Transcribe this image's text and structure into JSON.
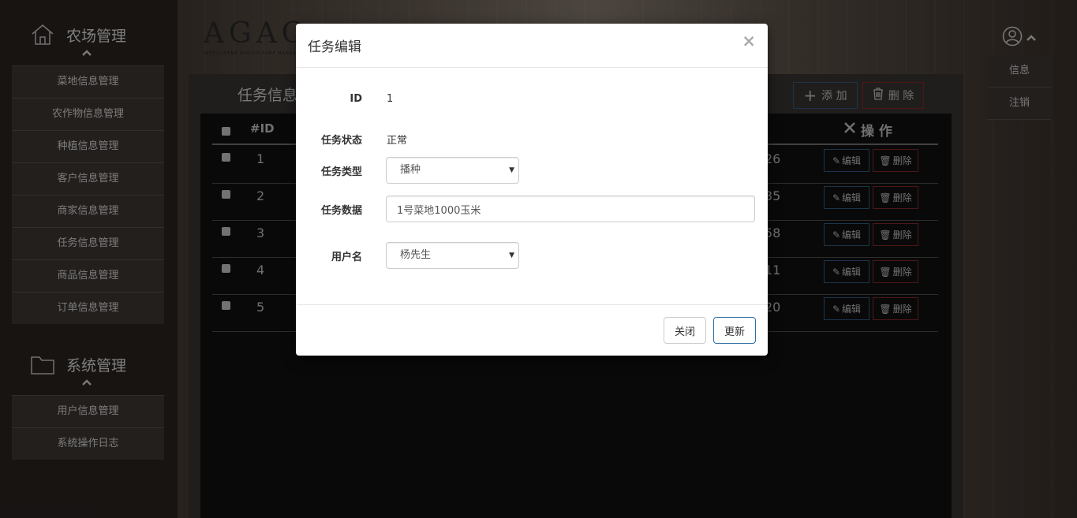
{
  "sidebar": {
    "farm_title": "农场管理",
    "farm_items": [
      {
        "label": "菜地信息管理"
      },
      {
        "label": "农作物信息管理"
      },
      {
        "label": "种植信息管理"
      },
      {
        "label": "客户信息管理"
      },
      {
        "label": "商家信息管理"
      },
      {
        "label": "任务信息管理"
      },
      {
        "label": "商品信息管理"
      },
      {
        "label": "订单信息管理"
      }
    ],
    "system_title": "系统管理",
    "system_items": [
      {
        "label": "用户信息管理"
      },
      {
        "label": "系统操作日志"
      }
    ]
  },
  "logo": {
    "text": "AGAC",
    "subtitle": "INTELLIGENT AGRICULTURE MANAGEMENT SYSTEM"
  },
  "main": {
    "title": "任务信息",
    "add_label": "添 加",
    "delete_label": "删 除",
    "table": {
      "id_header": "#ID",
      "op_header": "操 作",
      "edit_label": "编辑",
      "remove_label": "删除",
      "rows": [
        {
          "id": "1",
          "tail": "26"
        },
        {
          "id": "2",
          "tail": "35"
        },
        {
          "id": "3",
          "tail": "58"
        },
        {
          "id": "4",
          "tail": "11"
        },
        {
          "id": "5",
          "tail": "20"
        }
      ]
    }
  },
  "user_menu": {
    "items": [
      {
        "label": "信息"
      },
      {
        "label": "注销"
      }
    ]
  },
  "modal": {
    "title": "任务编辑",
    "close_glyph": "×",
    "fields": {
      "id_label": "ID",
      "id_value": "1",
      "status_label": "任务状态",
      "status_value": "正常",
      "type_label": "任务类型",
      "type_value": "播种",
      "data_label": "任务数据",
      "data_value": "1号菜地1000玉米",
      "user_label": "用户名",
      "user_value": "杨先生"
    },
    "close_button": "关闭",
    "update_button": "更新"
  }
}
